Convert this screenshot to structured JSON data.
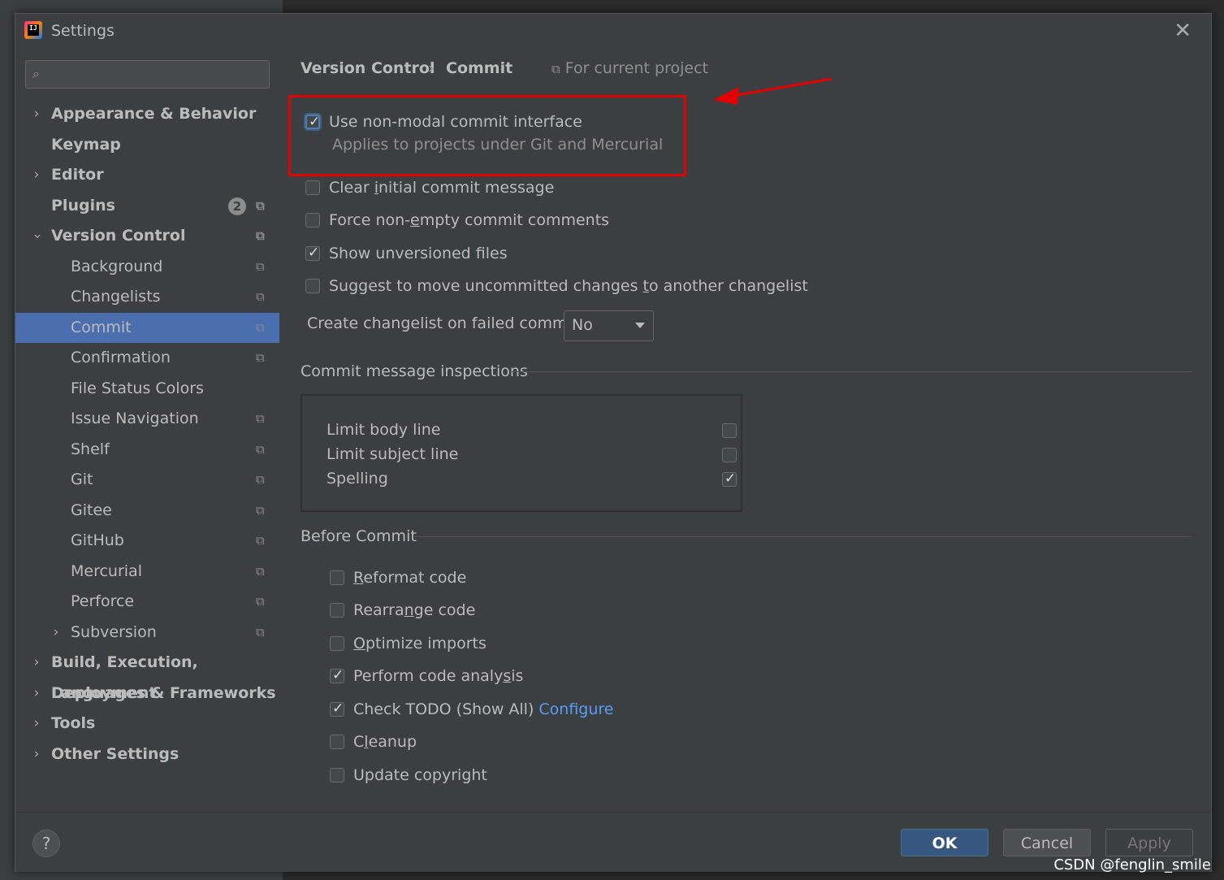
{
  "window": {
    "title": "Settings",
    "app_icon_text": "IJ"
  },
  "sidebar": {
    "search_placeholder": "",
    "items": [
      {
        "label": "Appearance & Behavior"
      },
      {
        "label": "Keymap"
      },
      {
        "label": "Editor"
      },
      {
        "label": "Plugins",
        "badge": "2"
      },
      {
        "label": "Version Control"
      },
      {
        "label": "Background"
      },
      {
        "label": "Changelists"
      },
      {
        "label": "Commit"
      },
      {
        "label": "Confirmation"
      },
      {
        "label": "File Status Colors"
      },
      {
        "label": "Issue Navigation"
      },
      {
        "label": "Shelf"
      },
      {
        "label": "Git"
      },
      {
        "label": "Gitee"
      },
      {
        "label": "GitHub"
      },
      {
        "label": "Mercurial"
      },
      {
        "label": "Perforce"
      },
      {
        "label": "Subversion"
      },
      {
        "label": "Build, Execution, Deployment"
      },
      {
        "label": "Languages & Frameworks"
      },
      {
        "label": "Tools"
      },
      {
        "label": "Other Settings"
      }
    ]
  },
  "breadcrumb": {
    "parent": "Version Control",
    "separator": "›",
    "current": "Commit",
    "scope_note": "For current project"
  },
  "options": {
    "non_modal": {
      "label": "Use non-modal commit interface",
      "sub": "Applies to projects under Git and Mercurial",
      "checked": true
    },
    "clear_initial": {
      "pre": "Clear ",
      "u": "i",
      "post": "nitial commit message",
      "checked": false
    },
    "force_nonempty": {
      "pre": "Force non-",
      "u": "e",
      "post": "mpty commit comments",
      "checked": false
    },
    "show_unversioned": {
      "label": "Show unversioned files",
      "checked": true
    },
    "suggest_move": {
      "pre": "Suggest to move uncommitted changes ",
      "u": "t",
      "post": "o another changelist",
      "checked": false
    }
  },
  "changelist_combo": {
    "label": "Create changelist on failed commit:",
    "value": "No"
  },
  "inspections": {
    "title": "Commit message inspections",
    "items": [
      {
        "label": "Limit body line",
        "checked": false
      },
      {
        "label": "Limit subject line",
        "checked": false
      },
      {
        "label": "Spelling",
        "checked": true
      }
    ]
  },
  "before_commit": {
    "title": "Before Commit",
    "items": [
      {
        "pre": "",
        "u": "R",
        "post": "eformat code",
        "checked": false
      },
      {
        "pre": "Rearra",
        "u": "n",
        "post": "ge code",
        "checked": false
      },
      {
        "pre": "",
        "u": "O",
        "post": "ptimize imports",
        "checked": false
      },
      {
        "pre": "Perform code analy",
        "u": "s",
        "post": "is",
        "checked": true
      },
      {
        "pre": "Check TODO (Show All) ",
        "u": "",
        "post": "",
        "checked": true,
        "link": "Configure"
      },
      {
        "pre": "C",
        "u": "l",
        "post": "eanup",
        "checked": false
      },
      {
        "pre": "Update copyright",
        "u": "",
        "post": "",
        "checked": false
      }
    ]
  },
  "footer": {
    "help_label": "?",
    "ok_label": "OK",
    "cancel_label": "Cancel",
    "apply_label": "Apply"
  },
  "watermark": "CSDN @fenglin_smile",
  "colors": {
    "selection": "#4b6eaf",
    "highlight_box": "#e50000",
    "link": "#589df6",
    "ok_button": "#365880"
  }
}
